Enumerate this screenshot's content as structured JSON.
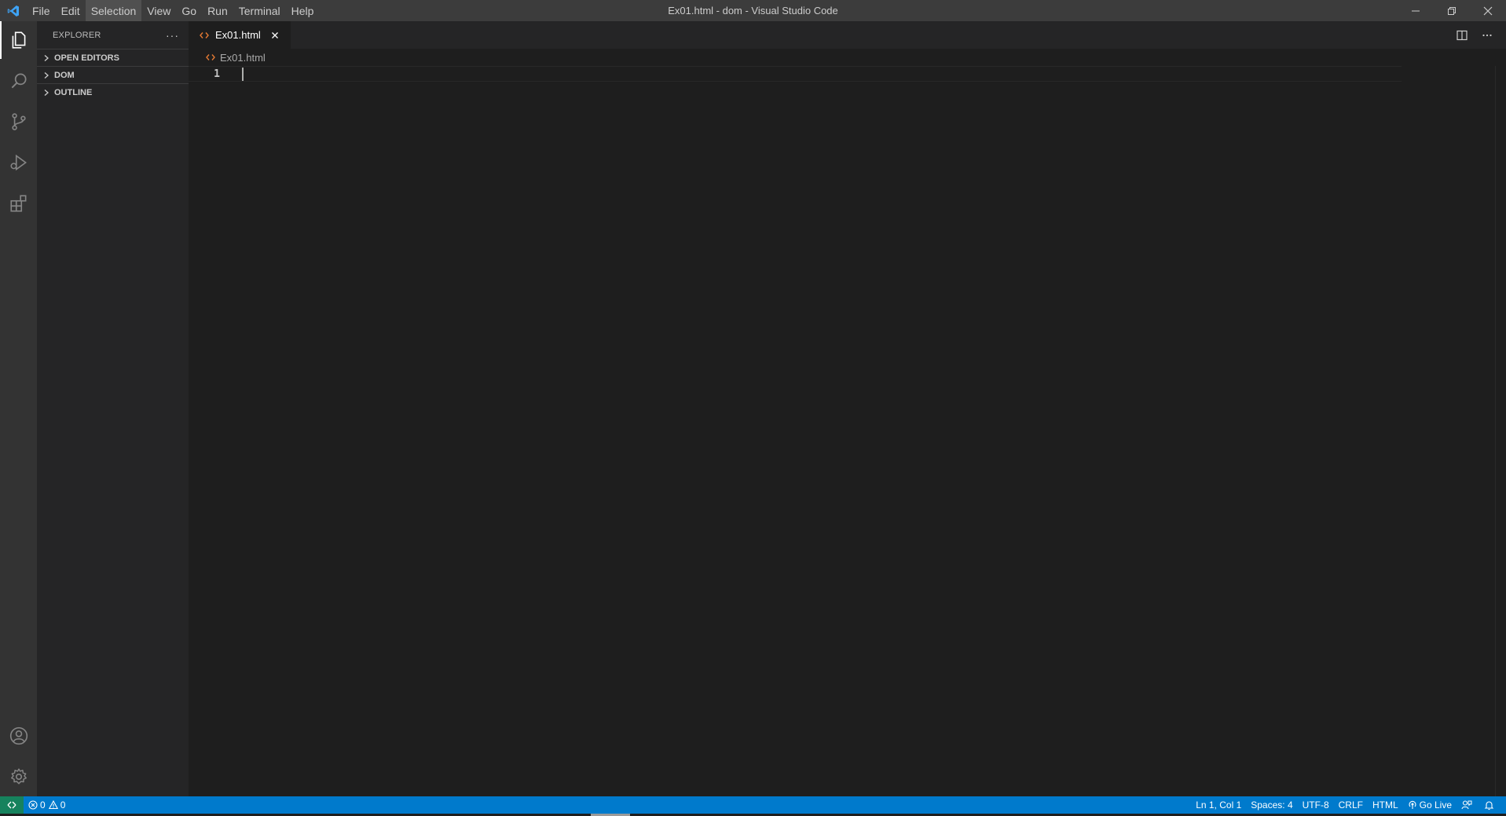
{
  "window": {
    "title": "Ex01.html - dom - Visual Studio Code",
    "controls": [
      "minimize-icon",
      "restore-icon",
      "close-icon"
    ]
  },
  "menu": {
    "file": "File",
    "edit": "Edit",
    "selection": "Selection",
    "view": "View",
    "go": "Go",
    "run": "Run",
    "terminal": "Terminal",
    "help": "Help",
    "active": "Selection"
  },
  "activity_bar": {
    "top": [
      "explorer-icon",
      "search-icon",
      "source-control-icon",
      "run-debug-icon",
      "extensions-icon"
    ],
    "bottom": [
      "account-icon",
      "manage-gear-icon"
    ],
    "active": "explorer-icon"
  },
  "sidebar": {
    "title": "EXPLORER",
    "more": "···",
    "sections": {
      "open_editors": "OPEN EDITORS",
      "dom": "DOM",
      "outline": "OUTLINE"
    }
  },
  "editor": {
    "tab_label": "Ex01.html",
    "breadcrumb": "Ex01.html",
    "line_number": "1",
    "tab_actions": [
      "split-editor-icon",
      "more-actions-icon"
    ]
  },
  "statusbar": {
    "errors": "0",
    "warnings": "0",
    "position": "Ln 1, Col 1",
    "spaces": "Spaces: 4",
    "encoding": "UTF-8",
    "eol": "CRLF",
    "language": "HTML",
    "golive": "Go Live"
  },
  "colors": {
    "titlebar": "#3c3c3c",
    "activitybar": "#333333",
    "sidebar": "#252526",
    "editor": "#1e1e1e",
    "statusbar": "#007acc",
    "remote": "#16825d",
    "html_icon": "#e37933",
    "vscode_logo": "#3ea3f5"
  }
}
